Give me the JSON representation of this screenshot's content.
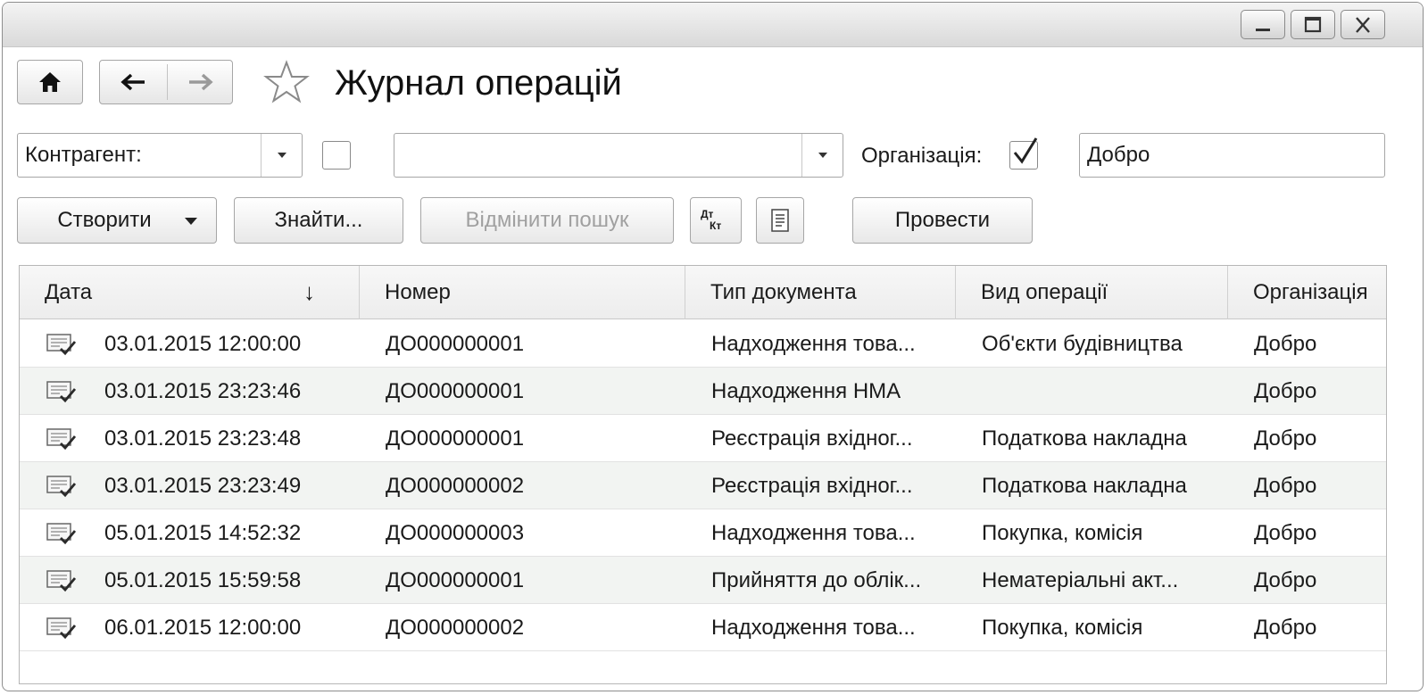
{
  "window": {
    "controls": [
      {
        "name": "minimize",
        "icon": "minimize-icon"
      },
      {
        "name": "maximize",
        "icon": "maximize-icon"
      },
      {
        "name": "close",
        "icon": "close-icon"
      }
    ]
  },
  "toolbar": {
    "home_icon": "home-icon",
    "back_icon": "arrow-left-icon",
    "forward_icon": "arrow-right-icon",
    "favorite_icon": "star-icon"
  },
  "page_title": "Журнал операцій",
  "filters": {
    "counterparty_label": "Контрагент:",
    "counterparty_value": "",
    "organization_label": "Організація:",
    "organization_checked": true,
    "organization_value": "Добро"
  },
  "actions": {
    "create": "Створити",
    "find": "Знайти...",
    "cancel_search": "Відмінити пошук",
    "dt_kt_top": "Дт",
    "dt_kt_bottom": "Кт",
    "post": "Провести"
  },
  "table": {
    "columns": [
      "Дата",
      "Номер",
      "Тип документа",
      "Вид операції",
      "Організація"
    ],
    "sort_indicator": "↓",
    "rows": [
      {
        "date": "03.01.2015 12:00:00",
        "number": "ДО000000001",
        "doc_type": "Надходження това...",
        "operation": "Об'єкти будівництва",
        "org": "Добро"
      },
      {
        "date": "03.01.2015 23:23:46",
        "number": "ДО000000001",
        "doc_type": "Надходження НМА",
        "operation": "",
        "org": "Добро"
      },
      {
        "date": "03.01.2015 23:23:48",
        "number": "ДО000000001",
        "doc_type": "Реєстрація вхідног...",
        "operation": "Податкова накладна",
        "org": "Добро"
      },
      {
        "date": "03.01.2015 23:23:49",
        "number": "ДО000000002",
        "doc_type": "Реєстрація вхідног...",
        "operation": "Податкова накладна",
        "org": "Добро"
      },
      {
        "date": "05.01.2015 14:52:32",
        "number": "ДО000000003",
        "doc_type": "Надходження това...",
        "operation": "Покупка, комісія",
        "org": "Добро"
      },
      {
        "date": "05.01.2015 15:59:58",
        "number": "ДО000000001",
        "doc_type": "Прийняття до облік...",
        "operation": "Нематеріальні акт...",
        "org": "Добро"
      },
      {
        "date": "06.01.2015 12:00:00",
        "number": "ДО000000002",
        "doc_type": "Надходження това...",
        "operation": "Покупка, комісія",
        "org": "Добро"
      }
    ]
  }
}
